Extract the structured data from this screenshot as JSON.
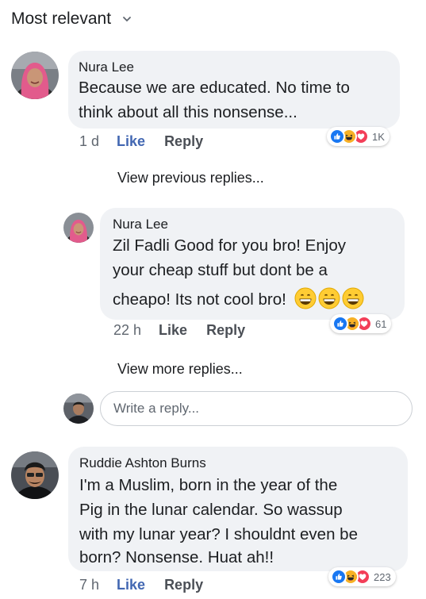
{
  "sort": {
    "label": "Most relevant",
    "icon": "chevron-down-icon"
  },
  "comments": [
    {
      "author": "Nura Lee",
      "lines": [
        "Because we are educated. No time to",
        "think about all this nonsense..."
      ],
      "time": "1 d",
      "like_label": "Like",
      "reply_label": "Reply",
      "reactions": {
        "icons": [
          "like-reaction-icon",
          "haha-reaction-icon",
          "love-reaction-icon"
        ],
        "count": "1K"
      }
    },
    {
      "author": "Nura Lee",
      "lines": [
        "Zil Fadli Good for you bro! Enjoy",
        "your cheap stuff but dont be a",
        "cheapo! Its not cool bro!"
      ],
      "emojis": [
        "grinning-emoji-icon",
        "grinning-emoji-icon",
        "grinning-emoji-icon"
      ],
      "time": "22 h",
      "like_label": "Like",
      "reply_label": "Reply",
      "reactions": {
        "icons": [
          "like-reaction-icon",
          "haha-reaction-icon",
          "love-reaction-icon"
        ],
        "count": "61"
      }
    },
    {
      "author": "Ruddie Ashton Burns",
      "lines": [
        "I'm a Muslim, born in the year of the",
        "Pig in the lunar calendar. So wassup",
        "with my lunar year? I shouldnt even be",
        "born? Nonsense. Huat ah!!"
      ],
      "time": "7 h",
      "like_label": "Like",
      "reply_label": "Reply",
      "reactions": {
        "icons": [
          "like-reaction-icon",
          "haha-reaction-icon",
          "love-reaction-icon"
        ],
        "count": "223"
      }
    }
  ],
  "view_previous_replies": "View previous replies...",
  "view_more_replies": "View more replies...",
  "reply_input": {
    "placeholder": "Write a reply..."
  },
  "colors": {
    "like_blue": "#4267b2",
    "bubble_bg": "#f0f2f5",
    "love_red": "#f33e58",
    "haha_yellow": "#f7b125"
  }
}
